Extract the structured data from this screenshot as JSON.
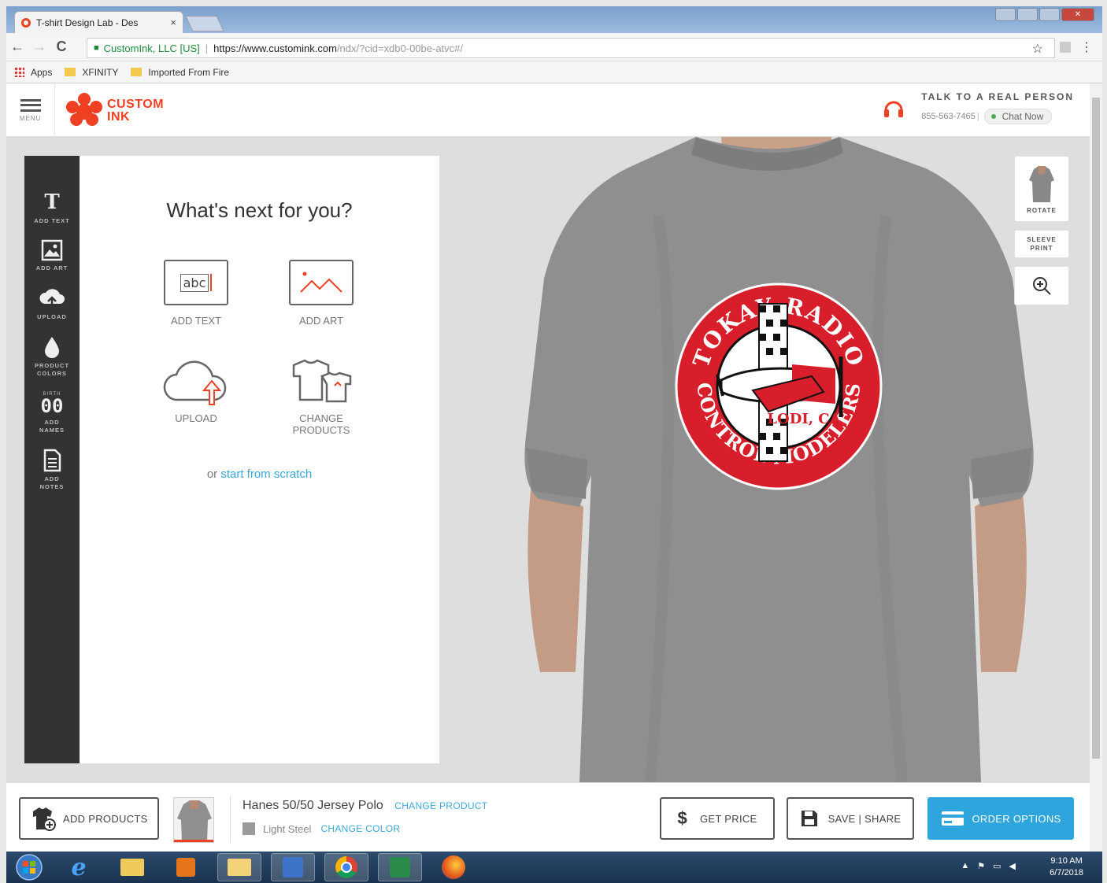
{
  "browser": {
    "tab_title": "T-shirt Design Lab - Des",
    "tab_close": "×",
    "back": "←",
    "forward": "→",
    "reload": "C",
    "secure_label": "CustomInk, LLC [US]",
    "url_main": "https://www.customink.com",
    "url_rest": "/ndx/?cid=xdb0-00be-atvc#/",
    "bookmarks": [
      "Apps",
      "XFINITY",
      "Imported From Fire"
    ]
  },
  "header": {
    "menu_label": "MENU",
    "logo_line1": "CUSTOM",
    "logo_line2": "INK",
    "talk_label": "TALK TO A REAL PERSON",
    "phone": "855-563-7465",
    "chat_label": "Chat Now"
  },
  "tools": [
    {
      "icon": "T",
      "label": "ADD TEXT"
    },
    {
      "icon": "image-icon",
      "label": "ADD ART"
    },
    {
      "icon": "cloud-upload-icon",
      "label": "UPLOAD"
    },
    {
      "icon": "drop-icon",
      "label": "PRODUCT COLORS"
    },
    {
      "icon": "jersey-number-icon",
      "label": "ADD NAMES"
    },
    {
      "icon": "notes-icon",
      "label": "ADD NOTES"
    }
  ],
  "tool_badge_names": "00",
  "tool_badge_names_top": "BIRTH",
  "panel": {
    "title": "What's next for you?",
    "add_text_sample": "abc",
    "choices": {
      "add_text": "ADD TEXT",
      "add_art": "ADD ART",
      "upload": "UPLOAD",
      "change_products_1": "CHANGE",
      "change_products_2": "PRODUCTS"
    },
    "scratch_prefix": "or",
    "scratch_link": "start from scratch"
  },
  "side_controls": {
    "rotate": "ROTATE",
    "sleeve_1": "SLEEVE",
    "sleeve_2": "PRINT"
  },
  "design": {
    "top_text": "TOKAY RADIO",
    "bottom_text": "CONTROL MODELERS",
    "location": "LODI, CA"
  },
  "bottom": {
    "add_products": "ADD PRODUCTS",
    "product_name": "Hanes 50/50 Jersey Polo",
    "change_product": "CHANGE PRODUCT",
    "color_name": "Light Steel",
    "change_color": "CHANGE COLOR",
    "get_price": "GET PRICE",
    "save_share": "SAVE | SHARE",
    "order_options": "ORDER OPTIONS"
  },
  "taskbar": {
    "time": "9:10 AM",
    "date": "6/7/2018"
  },
  "colors": {
    "brand": "#ef4023",
    "accent_blue": "#2ea5dc",
    "shirt": "#8f8f8f",
    "badge_red": "#d81e2a"
  }
}
